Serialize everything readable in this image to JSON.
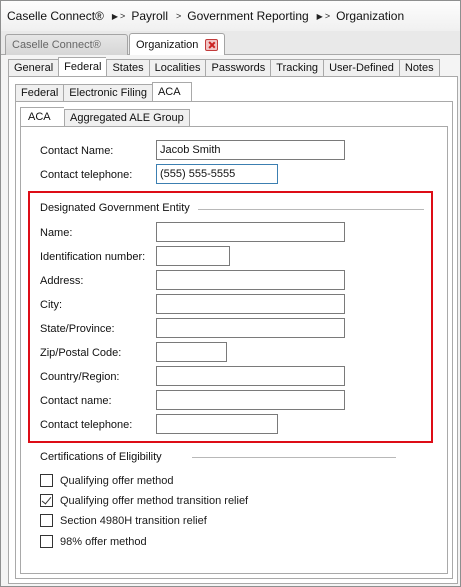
{
  "breadcrumb": {
    "items": [
      "Caselle Connect®",
      "Payroll",
      "Government Reporting",
      "Organization"
    ],
    "separator": ">"
  },
  "doc_tabs": [
    {
      "label": "Caselle Connect®",
      "active": false
    },
    {
      "label": "Organization",
      "active": true
    }
  ],
  "main_tabs": [
    "General",
    "Federal",
    "States",
    "Localities",
    "Passwords",
    "Tracking",
    "User-Defined",
    "Notes"
  ],
  "main_tab_active": "Federal",
  "federal_tabs": [
    "Federal",
    "Electronic Filing",
    "ACA"
  ],
  "federal_tab_active": "ACA",
  "aca_tabs": [
    "ACA",
    "Aggregated ALE Group"
  ],
  "aca_tab_active": "ACA",
  "contact": {
    "name_label": "Contact Name:",
    "name_value": "Jacob Smith",
    "phone_label": "Contact telephone:",
    "phone_value": "(555) 555-5555"
  },
  "dge": {
    "title": "Designated Government Entity",
    "fields": {
      "name": {
        "label": "Name:",
        "value": ""
      },
      "id_number": {
        "label": "Identification number:",
        "value": ""
      },
      "address": {
        "label": "Address:",
        "value": ""
      },
      "city": {
        "label": "City:",
        "value": ""
      },
      "state": {
        "label": "State/Province:",
        "value": ""
      },
      "zip": {
        "label": "Zip/Postal Code:",
        "value": ""
      },
      "country": {
        "label": "Country/Region:",
        "value": ""
      },
      "contact_name": {
        "label": "Contact name:",
        "value": ""
      },
      "contact_phone": {
        "label": "Contact telephone:",
        "value": ""
      }
    },
    "highlight_color": "#dd0d17"
  },
  "certifications": {
    "title": "Certifications of Eligibility",
    "items": [
      {
        "label": "Qualifying offer method",
        "checked": false
      },
      {
        "label": "Qualifying offer method transition relief",
        "checked": true
      },
      {
        "label": "Section 4980H transition relief",
        "checked": false
      },
      {
        "label": "98% offer method",
        "checked": false
      }
    ]
  }
}
